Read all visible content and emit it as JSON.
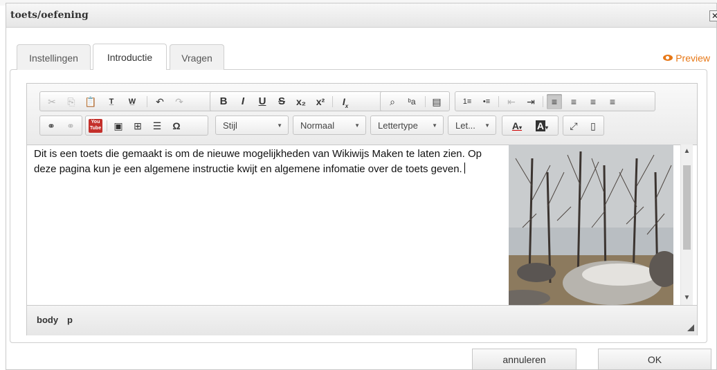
{
  "dialog": {
    "title": "toets/oefening",
    "close_label": "✕"
  },
  "tabs": [
    {
      "label": "Instellingen",
      "active": false
    },
    {
      "label": "Introductie",
      "active": true
    },
    {
      "label": "Vragen",
      "active": false
    }
  ],
  "preview": {
    "label": "Preview",
    "icon": "eye-icon",
    "color": "#e77817"
  },
  "toolbar": {
    "row1": {
      "clipboard": [
        {
          "name": "cut-icon",
          "glyph": "✂",
          "enabled": false
        },
        {
          "name": "copy-icon",
          "glyph": "⎘",
          "enabled": false
        },
        {
          "name": "paste-icon",
          "glyph": "📋",
          "enabled": true
        },
        {
          "name": "paste-text-icon",
          "glyph": "T",
          "enabled": true
        },
        {
          "name": "paste-word-icon",
          "glyph": "W",
          "enabled": true
        },
        {
          "name": "undo-icon",
          "glyph": "↶",
          "enabled": true
        },
        {
          "name": "redo-icon",
          "glyph": "↷",
          "enabled": false
        }
      ],
      "basicstyles": [
        {
          "name": "bold-icon",
          "glyph": "B"
        },
        {
          "name": "italic-icon",
          "glyph": "I"
        },
        {
          "name": "underline-icon",
          "glyph": "U"
        },
        {
          "name": "strikethrough-icon",
          "glyph": "S"
        },
        {
          "name": "subscript-icon",
          "glyph": "x₂"
        },
        {
          "name": "superscript-icon",
          "glyph": "x²"
        },
        {
          "name": "remove-format-icon",
          "glyph": "Ix"
        }
      ],
      "editing": [
        {
          "name": "find-icon",
          "glyph": "🔍"
        },
        {
          "name": "replace-icon",
          "glyph": "ba"
        },
        {
          "name": "show-blocks-icon",
          "glyph": "▤"
        }
      ],
      "paragraph": [
        {
          "name": "numbered-list-icon",
          "glyph": "1≡",
          "enabled": true
        },
        {
          "name": "bulleted-list-icon",
          "glyph": "•≡",
          "enabled": true
        },
        {
          "name": "outdent-icon",
          "glyph": "⇤",
          "enabled": false
        },
        {
          "name": "indent-icon",
          "glyph": "⇥",
          "enabled": true
        },
        {
          "name": "align-left-icon",
          "glyph": "≡",
          "active": true
        },
        {
          "name": "align-center-icon",
          "glyph": "≡"
        },
        {
          "name": "align-right-icon",
          "glyph": "≡"
        },
        {
          "name": "justify-icon",
          "glyph": "≡"
        }
      ]
    },
    "row2": {
      "links": [
        {
          "name": "link-icon",
          "glyph": "∞",
          "enabled": true
        },
        {
          "name": "unlink-icon",
          "glyph": "∞",
          "enabled": false
        }
      ],
      "youtube_label": "You Tube",
      "insert": [
        {
          "name": "image-icon",
          "glyph": "▣"
        },
        {
          "name": "table-icon",
          "glyph": "⊞"
        },
        {
          "name": "horizontal-line-icon",
          "glyph": "☰"
        },
        {
          "name": "special-char-icon",
          "glyph": "Ω"
        }
      ],
      "combos": [
        {
          "name": "style-combo",
          "label": "Stijl"
        },
        {
          "name": "format-combo",
          "label": "Normaal"
        },
        {
          "name": "font-combo",
          "label": "Lettertype"
        },
        {
          "name": "size-combo",
          "label": "Let..."
        }
      ],
      "text_color_label": "A",
      "bg_color_label": "A",
      "maximize_glyph": "⤢",
      "source_glyph": "▯"
    }
  },
  "content": {
    "paragraph": "Dit is een toets die gemaakt is om de nieuwe mogelijkheden van Wikiwijs Maken te laten zien. Op deze pagina kun je een algemene instructie kwijt en algemene infomatie over de toets geven."
  },
  "elementspath": [
    "body",
    "p"
  ],
  "footer": {
    "cancel_label": "annuleren",
    "ok_label": "OK"
  }
}
